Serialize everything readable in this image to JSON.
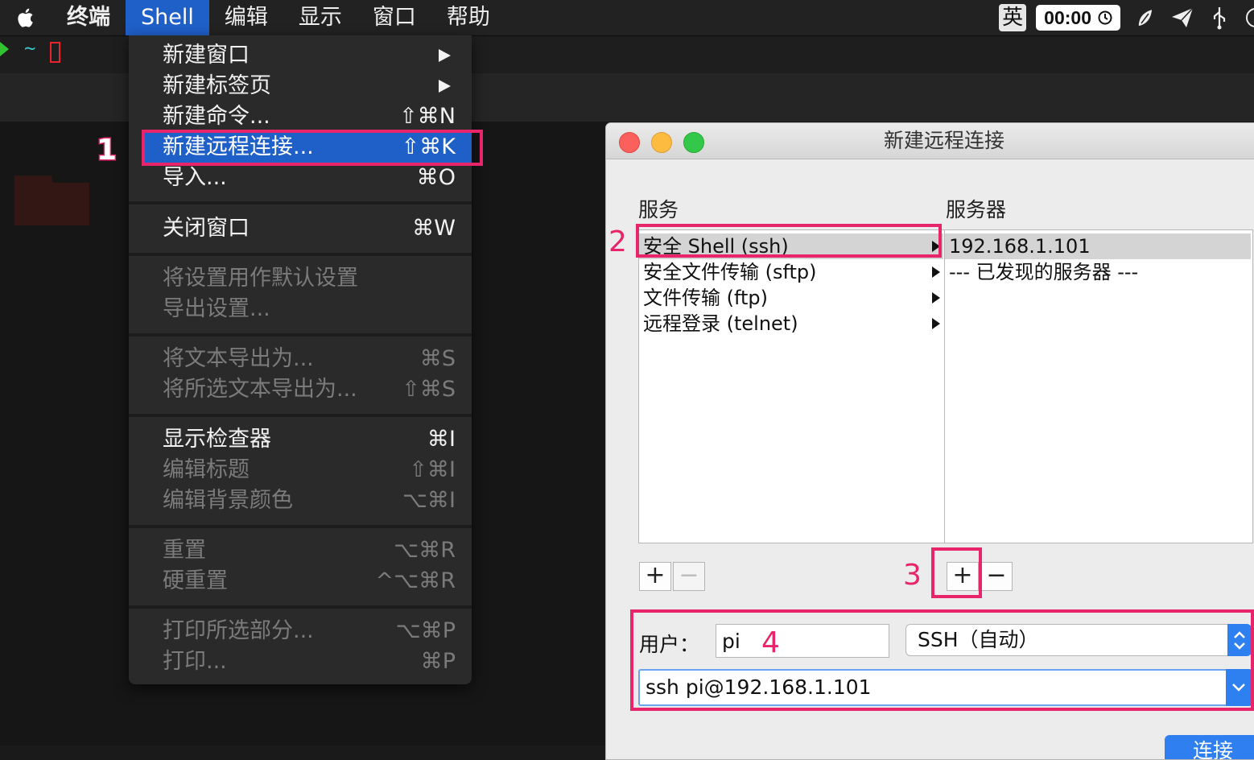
{
  "menubar": {
    "app": "终端",
    "items": [
      "Shell",
      "编辑",
      "显示",
      "窗口",
      "帮助"
    ],
    "ime": "英",
    "clock": "00:00"
  },
  "terminal": {
    "prompt": "~"
  },
  "shell_menu": {
    "new_window": "新建窗口",
    "new_tab": "新建标签页",
    "new_command": "新建命令...",
    "new_command_sc": "⇧⌘N",
    "new_remote": "新建远程连接...",
    "new_remote_sc": "⇧⌘K",
    "import": "导入...",
    "import_sc": "⌘O",
    "close_window": "关闭窗口",
    "close_window_sc": "⌘W",
    "use_default": "将设置用作默认设置",
    "export_settings": "导出设置...",
    "export_text": "将文本导出为...",
    "export_text_sc": "⌘S",
    "export_selected": "将所选文本导出为...",
    "export_selected_sc": "⇧⌘S",
    "show_inspector": "显示检查器",
    "show_inspector_sc": "⌘I",
    "edit_title": "编辑标题",
    "edit_title_sc": "⇧⌘I",
    "edit_bg": "编辑背景颜色",
    "edit_bg_sc": "⌥⌘I",
    "reset": "重置",
    "reset_sc": "⌥⌘R",
    "hard_reset": "硬重置",
    "hard_reset_sc": "^⌥⌘R",
    "print_selection": "打印所选部分...",
    "print_selection_sc": "⌥⌘P",
    "print": "打印...",
    "print_sc": "⌘P"
  },
  "dialog": {
    "title": "新建远程连接",
    "services_header": "服务",
    "servers_header": "服务器",
    "services": [
      "安全 Shell (ssh)",
      "安全文件传输 (sftp)",
      "文件传输 (ftp)",
      "远程登录 (telnet)"
    ],
    "servers": [
      "192.168.1.101",
      "--- 已发现的服务器 ---"
    ],
    "plus": "+",
    "minus": "−",
    "user_label": "用户：",
    "user_value": "pi",
    "protocol": "SSH（自动）",
    "command": "ssh pi@192.168.1.101",
    "connect": "连接"
  },
  "annotations": [
    "1",
    "2",
    "3",
    "4"
  ]
}
